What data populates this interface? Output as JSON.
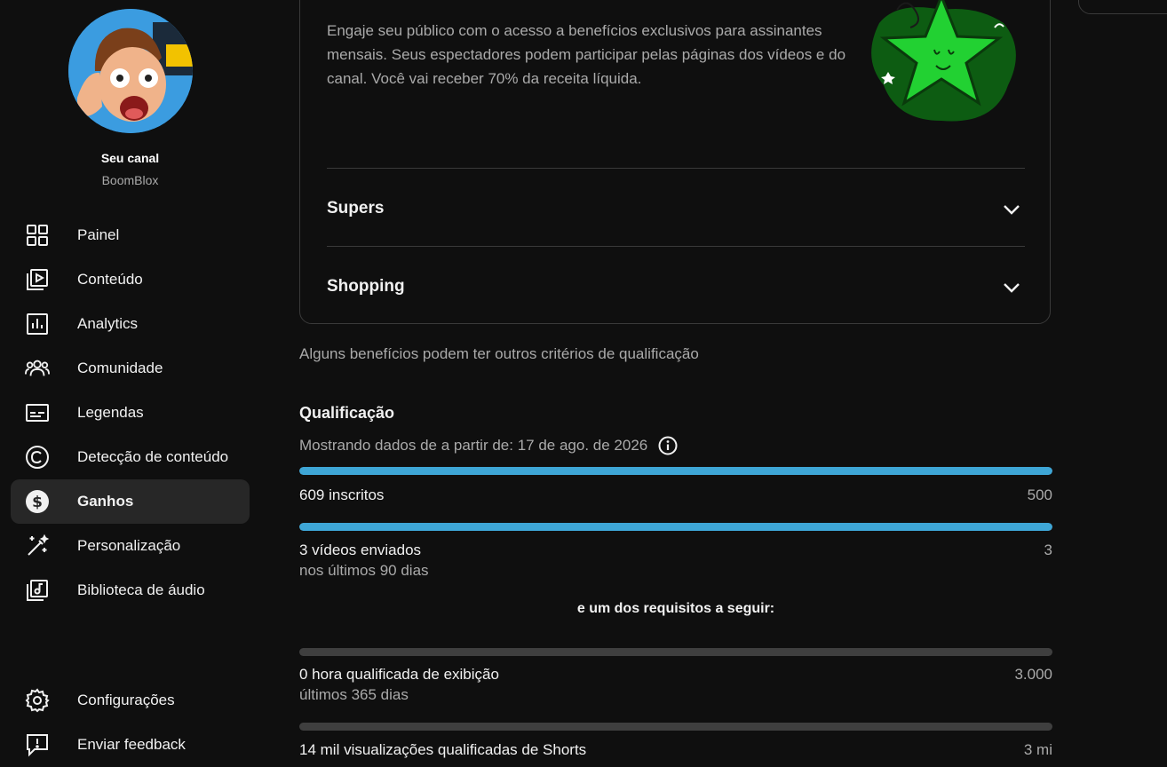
{
  "sidebar": {
    "channel_title": "Seu canal",
    "channel_name": "BoomBlox",
    "items": [
      {
        "label": "Painel",
        "icon": "dashboard-icon",
        "active": false
      },
      {
        "label": "Conteúdo",
        "icon": "content-icon",
        "active": false
      },
      {
        "label": "Analytics",
        "icon": "analytics-icon",
        "active": false
      },
      {
        "label": "Comunidade",
        "icon": "community-icon",
        "active": false
      },
      {
        "label": "Legendas",
        "icon": "subtitles-icon",
        "active": false
      },
      {
        "label": "Detecção de conteúdo",
        "icon": "copyright-icon",
        "active": false
      },
      {
        "label": "Ganhos",
        "icon": "earn-icon",
        "active": true
      },
      {
        "label": "Personalização",
        "icon": "customization-icon",
        "active": false
      },
      {
        "label": "Biblioteca de áudio",
        "icon": "audio-library-icon",
        "active": false
      }
    ],
    "bottom_items": [
      {
        "label": "Configurações",
        "icon": "settings-icon"
      },
      {
        "label": "Enviar feedback",
        "icon": "feedback-icon"
      }
    ]
  },
  "card": {
    "description": "Engaje seu público com o acesso a benefícios exclusivos para assinantes mensais. Seus espectadores podem participar pelas páginas dos vídeos e do canal. Você vai receber 70% da receita líquida.",
    "expanders": [
      "Supers",
      "Shopping"
    ]
  },
  "note": "Alguns benefícios podem ter outros critérios de qualificação",
  "qualification": {
    "title": "Qualificação",
    "subtitle": "Mostrando dados de a partir de: 17 de ago. de 2026",
    "requirements": [
      {
        "label": "609 inscritos",
        "sub": "",
        "target": "500",
        "progress": 1.0
      },
      {
        "label": "3 vídeos enviados",
        "sub": "nos últimos 90 dias",
        "target": "3",
        "progress": 1.0
      }
    ],
    "middle_note": "e um dos requisitos a seguir:",
    "optional_requirements": [
      {
        "label": "0 hora qualificada de exibição",
        "sub": "últimos 365 dias",
        "target": "3.000",
        "progress": 0.0
      },
      {
        "label": "14 mil visualizações qualificadas de Shorts",
        "sub": "",
        "target": "3 mi",
        "progress": 0.0
      }
    ]
  },
  "colors": {
    "progress_fill": "#3ea6d6",
    "progress_track": "#3f3f3f",
    "active_nav": "#272727"
  }
}
